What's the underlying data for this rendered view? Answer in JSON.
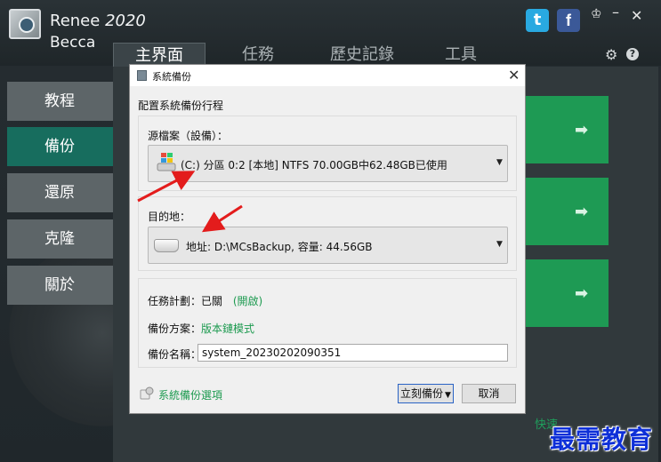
{
  "app": {
    "name": "Renee",
    "version": "2020",
    "subtitle": "Becca",
    "tabs": [
      "主界面",
      "任務",
      "歷史記錄",
      "工具"
    ],
    "sidebar": [
      "教程",
      "備份",
      "還原",
      "克隆",
      "關於"
    ],
    "quick_link": "快速..."
  },
  "dialog": {
    "title": "系統備份",
    "heading": "配置系統備份行程",
    "source": {
      "label": "源檔案（設備）：",
      "value": "(C:) 分區 0:2 [本地] NTFS   70.00GB中62.48GB已使用"
    },
    "destination": {
      "label": "目的地：",
      "value": "地址: D:\\MCsBackup, 容量: 44.56GB"
    },
    "schedule": {
      "label": "任務計劃：已關",
      "action": "(開啟)"
    },
    "scheme": {
      "label": "備份方案：",
      "value": "版本鏈模式"
    },
    "backup_name": {
      "label": "備份名稱：",
      "value": "system_20230202090351"
    },
    "options_link": "系統備份選項",
    "backup_button": "立刻備份",
    "cancel_button": "取消"
  },
  "watermark": "最需教育",
  "colors": {
    "accent_green": "#1e9a54",
    "sidebar_active": "#176d5e",
    "annotation_arrow": "#e31c1c"
  }
}
